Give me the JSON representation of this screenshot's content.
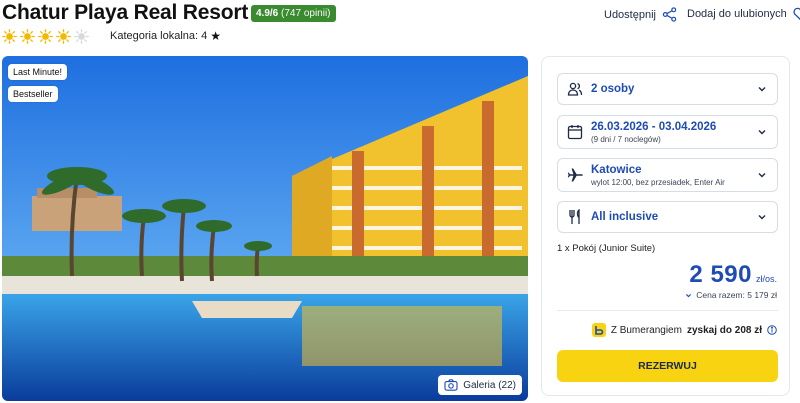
{
  "hotel": {
    "name": "Chatur Playa Real Resort",
    "rating_score": "4.9/6",
    "rating_count": "(747 opinii)",
    "sun_rating": 4,
    "sun_max": 5,
    "category_label": "Kategoria lokalna:",
    "category_value": "4"
  },
  "actions": {
    "share_label": "Udostępnij",
    "favorite_label": "Dodaj do ulubionych"
  },
  "photo": {
    "tags": [
      "Last Minute!",
      "Bestseller"
    ],
    "gallery_label": "Galeria (22)"
  },
  "booking": {
    "guests": "2 osoby",
    "dates": "26.03.2026 - 03.04.2026",
    "dates_detail": "(9 dni / 7 noclegów)",
    "departure_city": "Katowice",
    "departure_detail": "wylot 12:00, bez przesiadek, Enter Air",
    "board": "All inclusive",
    "room": "1 x Pokój  (Junior Suite)",
    "price": "2 590",
    "price_unit": "zł/os.",
    "total_price": "Cena razem: 5 179 zł",
    "bumerang_text": "Z Bumerangiem",
    "bumerang_bold": "zyskaj do 208 zł",
    "book_button": "REZERWUJ"
  },
  "colors": {
    "accent": "#1e4bb5",
    "rating_badge": "#3a8b2f",
    "book_button": "#f7d312",
    "sun": "#f5b800"
  }
}
